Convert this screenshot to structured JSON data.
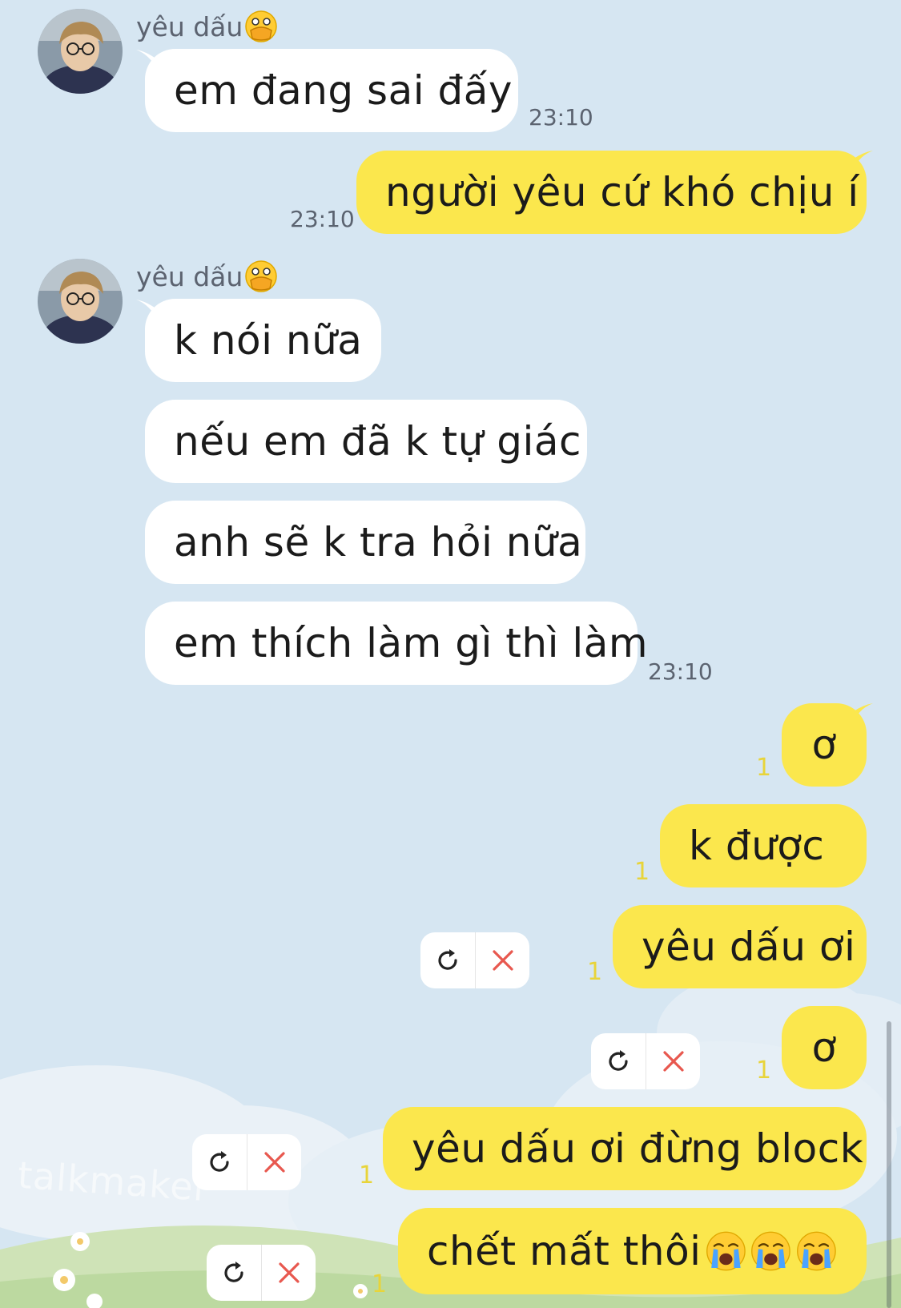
{
  "app": {
    "watermark": "talkmaker"
  },
  "colors": {
    "background": "#d6e6f2",
    "incoming_bubble": "#ffffff",
    "outgoing_bubble": "#fbe74d",
    "unread_count": "#e8d43a"
  },
  "messages": [
    {
      "sender": "yêu dấu",
      "sender_emoji": "face-with-open-eyes-and-hand-over-mouth",
      "text": "em đang sai đấy",
      "time": "23:10"
    },
    {
      "text": "người yêu cứ khó chịu í",
      "time": "23:10"
    },
    {
      "sender": "yêu dấu",
      "sender_emoji": "face-with-open-eyes-and-hand-over-mouth",
      "text": "k nói nữa"
    },
    {
      "text": "nếu em đã k tự giác"
    },
    {
      "text": "anh sẽ k tra hỏi nữa"
    },
    {
      "text": "em thích làm gì thì làm",
      "time": "23:10"
    },
    {
      "text": "ơ",
      "unread": "1"
    },
    {
      "text": "k được",
      "unread": "1"
    },
    {
      "text": "yêu dấu ơi",
      "unread": "1",
      "failed": true
    },
    {
      "text": "ơ",
      "unread": "1",
      "failed": true
    },
    {
      "text": "yêu dấu ơi đừng block",
      "unread": "1",
      "failed": true
    },
    {
      "text": "chết mất thôi",
      "emoji": [
        "loudly-crying-face",
        "loudly-crying-face",
        "loudly-crying-face"
      ],
      "unread": "1",
      "failed": true
    }
  ],
  "icons": {
    "retry": "refresh-icon",
    "delete": "close-icon"
  }
}
